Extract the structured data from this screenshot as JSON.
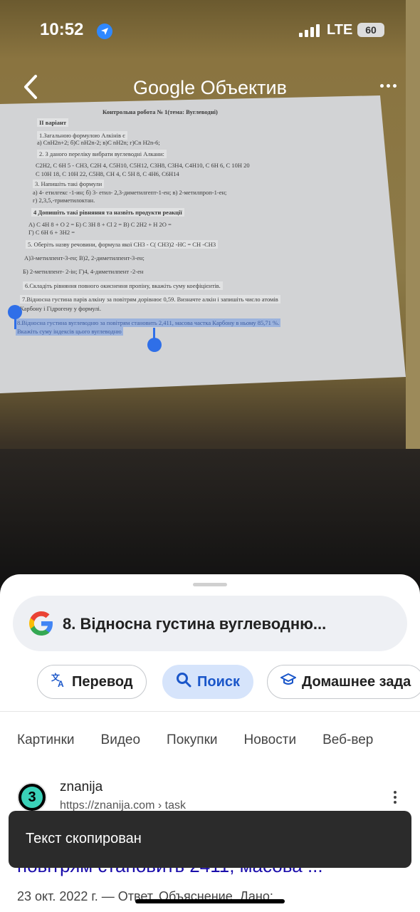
{
  "status_bar": {
    "time": "10:52",
    "network": "LTE",
    "battery": "60"
  },
  "header": {
    "title": "Google Объектив"
  },
  "document": {
    "title": "Контрольна робота № 1(тема:  Вуглеводні)",
    "variant": "II варіант",
    "lines": [
      "1.Загальною формулою Алкінів   є",
      "а) CnH2n+2;      б)C nH2n-2;      в)C nH2n;      г)Cn H2n-6;",
      "2. З даного переліку вибрати вуглеводні  Алкани:",
      "C2H2,   C 6H 5 - CH3,    C2H 4,    C5H10,    C5H12,    C3H8,    C3H4,    C4H10,   C 6H 6,  C 10H 20",
      "C 10H 18,   C 10H 22,    C5H8,     CH 4,    C 5H 8,    C 4H6,    C6H14",
      "3.  Напишіть такі формули",
      "а) 4-   етилгекс -1-ин;         б) 3- етил- 2,3-диметилгепт-1-ен;                 в) 2-метилпроп-1-ен;",
      "г) 2,3,5,-триметилоктан.",
      "4  Допишіть  такі  рівняння  та назвіть продукти реакції",
      "А)  C 4H 8  + O 2  =                  Б) C 3H 8  + Cl 2  =                              В)  C 2H2 + H 2O =",
      "Г)  C 6H 6  + 3H2   =",
      "5.  Оберіть назву речовини, формула якої   CH3 - C( CH3)2 -HC = CH -CH3",
      "А)3-метилпент-3-ен;                        В)2, 2-диметилпент-3-ен;",
      "Б) 2-метилпент- 2-ін;                        Г)4, 4-диметилпент -2-ен",
      "6.Складіть рівняння повного окиснення пропіну, вкажіть суму  коефіцієнтів.",
      "7.Відносна густина парів алкіну за повітрям   дорівнює  0,59. Визначте алкін і запишіть число атомів",
      "Карбону і Гідрогену у формулі."
    ],
    "selected_lines": [
      "8.Відносна густина вуглеводню за повітрям     становить   2,411,  масова частка   Карбону в ньому 85,71 %.",
      "Вкажіть суму індексів цього вуглеводню"
    ]
  },
  "sheet": {
    "query": "8. Відносна густина вуглеводню...",
    "chips": [
      {
        "label": "Перевод",
        "icon": "translate-icon"
      },
      {
        "label": "Поиск",
        "icon": "search-icon"
      },
      {
        "label": "Домашнее зада",
        "icon": "graduation-cap-icon"
      }
    ],
    "tabs": [
      "Картинки",
      "Видео",
      "Покупки",
      "Новости",
      "Веб-вер"
    ],
    "result": {
      "site_name": "znanija",
      "url": "https://znanija.com › task",
      "title": "повітрям становить 2411, масова ...",
      "date_line": "23 окт. 2022 г. — Ответ. Объяснение. Дано:"
    }
  },
  "toast": {
    "message": "Текст скопирован"
  }
}
